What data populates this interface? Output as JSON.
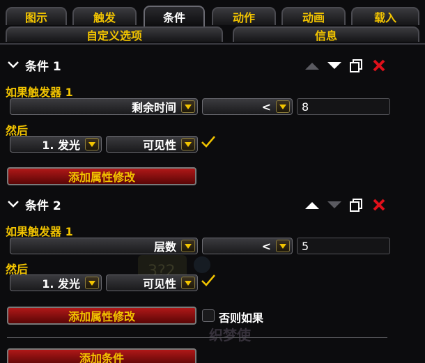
{
  "tabs_row1": [
    {
      "label": "图示"
    },
    {
      "label": "触发"
    },
    {
      "label": "条件"
    },
    {
      "label": "动作"
    },
    {
      "label": "动画"
    },
    {
      "label": "载入"
    }
  ],
  "tabs_row2": [
    {
      "label": "自定义选项"
    },
    {
      "label": "信息"
    }
  ],
  "background_word": "织梦使",
  "conditions": [
    {
      "title": "条件 1",
      "if_label": "如果触发器 1",
      "property": "剩余时间",
      "operator": "<",
      "value": "8",
      "then_label": "然后",
      "target": "1. 发光",
      "target_property": "可见性",
      "add_property_button": "添加属性修改"
    },
    {
      "title": "条件 2",
      "if_label": "如果触发器 1",
      "property": "层数",
      "operator": "<",
      "value": "5",
      "then_label": "然后",
      "target": "1. 发光",
      "target_property": "可见性",
      "add_property_button": "添加属性修改",
      "else_if_label": "否则如果"
    }
  ],
  "add_condition_button": "添加条件",
  "colors": {
    "accent_yellow": "#f2c400",
    "delete_red": "#e0101a",
    "button_red": "#a01212"
  }
}
